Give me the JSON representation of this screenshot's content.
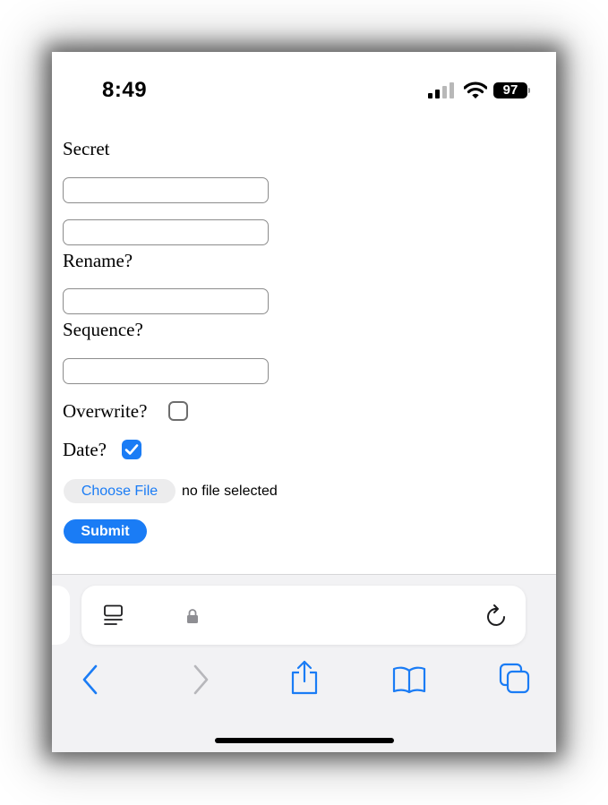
{
  "status_bar": {
    "time": "8:49",
    "battery": "97"
  },
  "form": {
    "secret_label": "Secret",
    "rename_label": "Rename?",
    "sequence_label": "Sequence?",
    "overwrite_label": "Overwrite?",
    "overwrite_checked": false,
    "date_label": "Date?",
    "date_checked": true,
    "choose_file_label": "Choose File",
    "file_status": "no file selected",
    "submit_label": "Submit"
  },
  "toolbar": {
    "icons": [
      "page-menu-icon",
      "lock-icon",
      "reload-icon",
      "back-icon",
      "forward-icon",
      "share-icon",
      "bookmarks-icon",
      "tabs-icon"
    ]
  },
  "colors": {
    "accent": "#1a7cf5",
    "chrome_bg": "#f2f2f4"
  }
}
